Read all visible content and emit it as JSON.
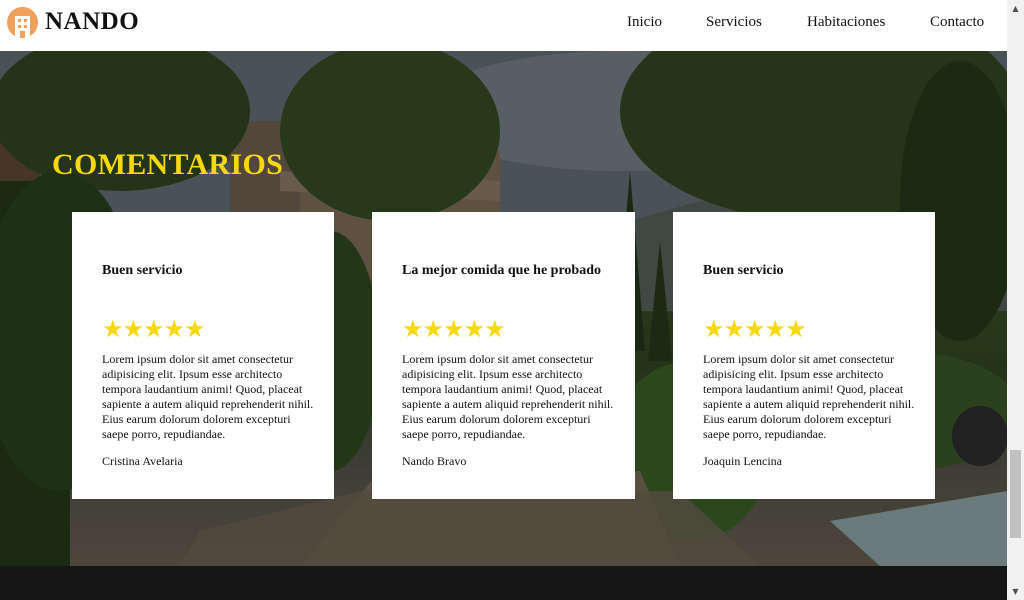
{
  "header": {
    "brand": "NANDO",
    "logo_icon": "hotel-building-icon",
    "nav": [
      {
        "label": "Inicio"
      },
      {
        "label": "Servicios"
      },
      {
        "label": "Habitaciones"
      },
      {
        "label": "Contacto"
      }
    ]
  },
  "section": {
    "title": "COMENTARIOS"
  },
  "comments": [
    {
      "title": "Buen servicio",
      "stars": "★★★★★",
      "rating": 5,
      "text": "Lorem ipsum dolor sit amet consectetur adipisicing elit. Ipsum esse architecto tempora laudantium animi! Quod, placeat sapiente a autem aliquid reprehenderit nihil. Eius earum dolorum dolorem excepturi saepe porro, repudiandae.",
      "author": "Cristina Avelaria"
    },
    {
      "title": "La mejor comida que he probado",
      "stars": "★★★★★",
      "rating": 5,
      "text": "Lorem ipsum dolor sit amet consectetur adipisicing elit. Ipsum esse architecto tempora laudantium animi! Quod, placeat sapiente a autem aliquid reprehenderit nihil. Eius earum dolorum dolorem excepturi saepe porro, repudiandae.",
      "author": "Nando Bravo"
    },
    {
      "title": "Buen servicio",
      "stars": "★★★★★",
      "rating": 5,
      "text": "Lorem ipsum dolor sit amet consectetur adipisicing elit. Ipsum esse architecto tempora laudantium animi! Quod, placeat sapiente a autem aliquid reprehenderit nihil. Eius earum dolorum dolorem excepturi saepe porro, repudiandae.",
      "author": "Joaquin Lencina"
    }
  ],
  "colors": {
    "accent": "#f5d90a",
    "logo": "#f0a05a",
    "footer": "#161616"
  }
}
